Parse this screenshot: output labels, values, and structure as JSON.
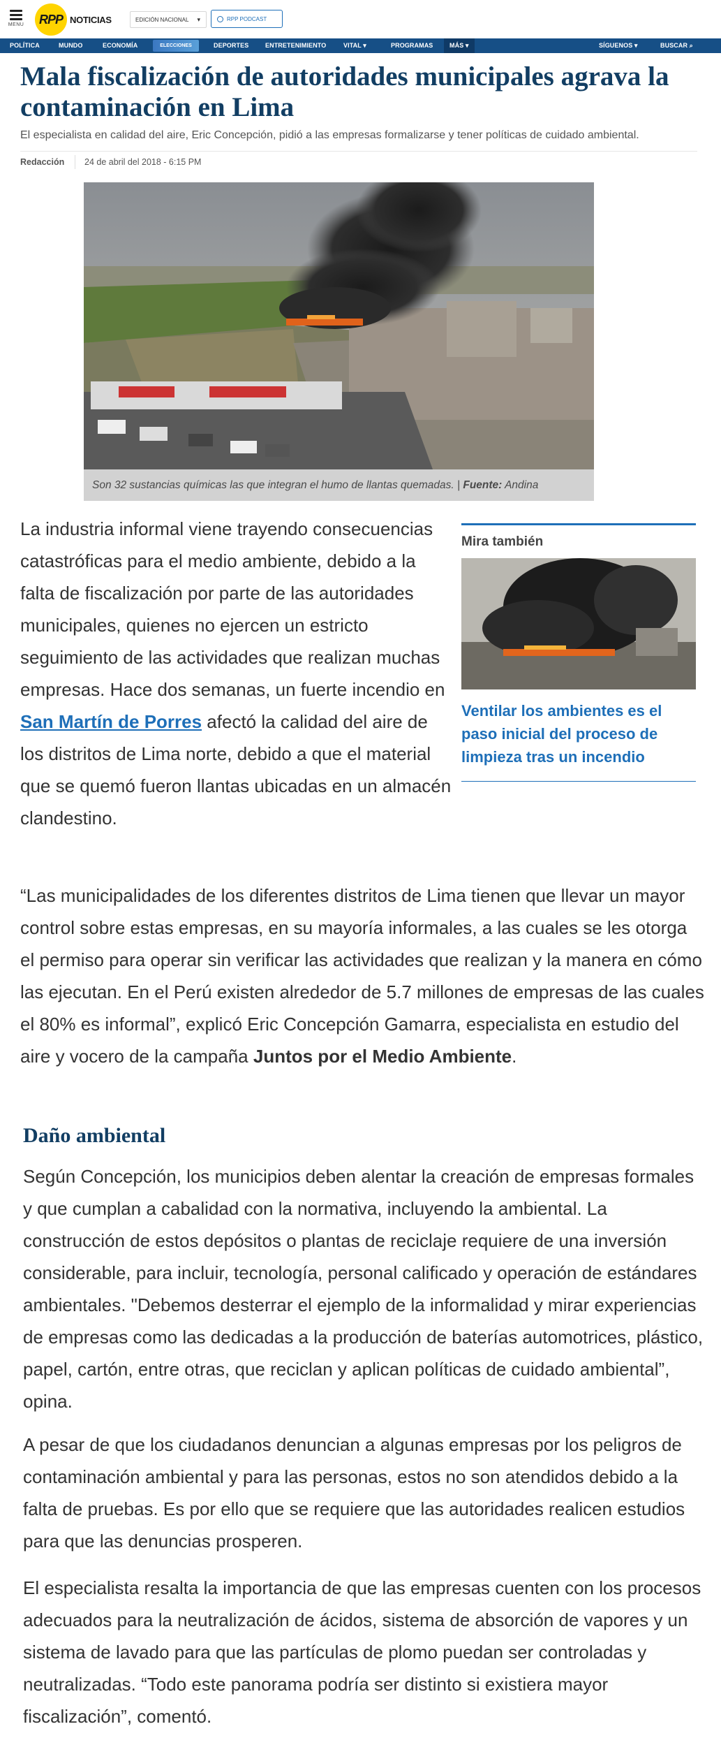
{
  "header": {
    "menu_label": "MENU",
    "logo_mark": "RPP",
    "logo_text": "NOTICIAS",
    "edition_label": "EDICIÓN NACIONAL",
    "podcast_label": "RPP PODCAST"
  },
  "nav": {
    "items": [
      "POLÍTICA",
      "MUNDO",
      "ECONOMÍA",
      "DEPORTES",
      "ENTRETENIMIENTO",
      "VITAL",
      "PROGRAMAS",
      "MÁS",
      "SÍGUENOS",
      "BUSCAR"
    ],
    "elecciones_label": "ELECCIONES"
  },
  "article": {
    "title": "Mala fiscalización de autoridades municipales agrava la contaminación en Lima",
    "subtitle": "El especialista en calidad del aire, Eric Concepción, pidió a las empresas formalizarse y tener políticas de cuidado ambiental.",
    "author": "Redacción",
    "date": "24 de abril del 2018 - 6:15 PM",
    "image_caption": "Son 32 sustancias químicas las que integran el humo de llantas quemadas. |",
    "image_source_label": "Fuente:",
    "image_source": "Andina",
    "p1_before": "La industria informal viene trayendo consecuencias catastróficas para el medio ambiente, debido a la falta de fiscalización por parte de las autoridades municipales, quienes no ejercen un estricto seguimiento de las actividades que realizan muchas empresas. Hace dos semanas, un fuerte incendio en ",
    "p1_link": "San Martín de Porres",
    "p1_after": " afectó la calidad del aire de los distritos de Lima norte, debido a que el material que se quemó fueron llantas ubicadas en un almacén clandestino.",
    "p2_before": "“Las municipalidades de los diferentes distritos de Lima tienen que llevar un mayor control sobre estas empresas, en su mayoría informales, a las cuales se les otorga el permiso para operar sin verificar las actividades que realizan y la manera en cómo las ejecutan. En el Perú existen alrededor de 5.7 millones de empresas de las cuales el 80% es informal”, explicó Eric Concepción Gamarra, especialista en estudio del aire y vocero de la campaña ",
    "p2_bold": "Juntos por el Medio Ambiente",
    "p2_after": ".",
    "section_title": "Daño ambiental",
    "p3": "Según Concepción, los municipios deben alentar la creación de empresas formales y que cumplan a cabalidad con la normativa, incluyendo la ambiental. La construcción de estos depósitos o plantas de reciclaje requiere de una inversión considerable, para incluir, tecnología, personal calificado y operación de estándares ambientales. \"Debemos desterrar el ejemplo de la informalidad y mirar experiencias de empresas como las dedicadas a la producción de baterías automotrices, plástico, papel, cartón, entre otras, que reciclan y aplican políticas de cuidado ambiental”, opina.",
    "p4": "A pesar de que los ciudadanos denuncian a algunas empresas por los peligros de contaminación ambiental y para las personas, estos no son atendidos debido a la falta de pruebas. Es por ello que se requiere que las autoridades realicen estudios para que las denuncias prosperen.",
    "p5": "El especialista resalta la importancia de que las empresas cuenten con los procesos adecuados para la neutralización de ácidos, sistema de absorción de vapores y un sistema de lavado para que las partículas de plomo puedan ser controladas y neutralizadas. “Todo este panorama podría ser distinto si existiera mayor fiscalización”, comentó."
  },
  "related": {
    "heading": "Mira también",
    "title": "Ventilar los ambientes es el paso inicial del proceso de limpieza tras un incendio"
  },
  "colors": {
    "nav_bg": "#164f86",
    "title": "#123e63",
    "link": "#1e6fb8",
    "logo_yellow": "#ffd400"
  }
}
